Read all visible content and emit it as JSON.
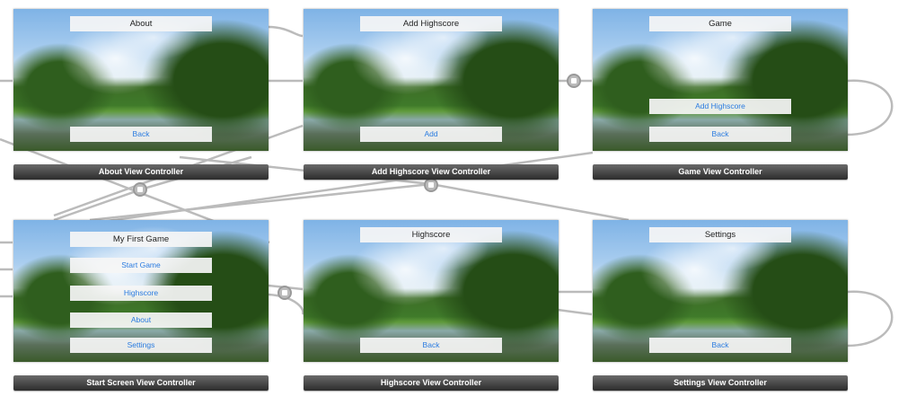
{
  "scenes": [
    {
      "name": "About View Controller",
      "title": "About",
      "buttons": [
        "Back"
      ]
    },
    {
      "name": "Add Highscore View Controller",
      "title": "Add Highscore",
      "buttons": [
        "Add"
      ]
    },
    {
      "name": "Game View Controller",
      "title": "Game",
      "buttons": [
        "Add Highscore",
        "Back"
      ]
    },
    {
      "name": "Start Screen View Controller",
      "title": "My First Game",
      "buttons": [
        "Start Game",
        "Highscore",
        "About",
        "Settings"
      ]
    },
    {
      "name": "Highscore View Controller",
      "title": "Highscore",
      "buttons": [
        "Back"
      ]
    },
    {
      "name": "Settings View Controller",
      "title": "Settings",
      "buttons": [
        "Back"
      ]
    }
  ],
  "colors": {
    "button_text": "#2a7be0",
    "label_bar": "#3a3a3a",
    "segue_line": "#aaaaaa"
  }
}
